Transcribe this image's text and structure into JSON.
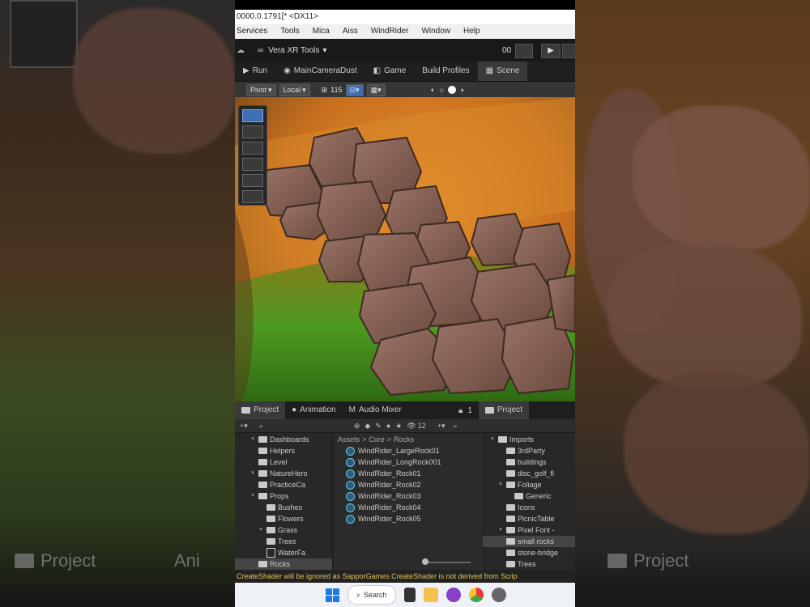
{
  "window": {
    "title": "0000.0.1791[* <DX11>"
  },
  "menu": [
    "Services",
    "Tools",
    "Mica",
    "Aiss",
    "WindRider",
    "Window",
    "Help"
  ],
  "toolbar": {
    "dropdown_label": "Vera XR Tools",
    "counter": "00"
  },
  "tabs": [
    {
      "label": "Run",
      "icon": "run-icon"
    },
    {
      "label": "MainCameraDust",
      "icon": "camera-icon"
    },
    {
      "label": "Game",
      "icon": "game-icon"
    },
    {
      "label": "Build Profiles",
      "icon": ""
    },
    {
      "label": "Scene",
      "icon": "scene-icon"
    }
  ],
  "scene_toolbar": {
    "pivot": "Pivot",
    "local": "Local",
    "snap_value": "115"
  },
  "bottom_left_tabs": [
    {
      "label": "Project",
      "icon": "folder-icon"
    },
    {
      "label": "Animation",
      "icon": "animation-icon"
    },
    {
      "label": "Audio Mixer",
      "icon": "audio-mixer-icon"
    }
  ],
  "bottom_left_counter": "1",
  "bottom_right_tab": {
    "label": "Project"
  },
  "asset_count": "12",
  "project_tree": [
    {
      "label": "Dashboards",
      "arrow": true,
      "depth": 1
    },
    {
      "label": "Helpers",
      "arrow": false,
      "depth": 1
    },
    {
      "label": "Level",
      "arrow": false,
      "depth": 1
    },
    {
      "label": "NatureHero",
      "arrow": true,
      "depth": 1
    },
    {
      "label": "PracticeCa",
      "arrow": false,
      "depth": 1
    },
    {
      "label": "Props",
      "arrow": true,
      "depth": 1
    },
    {
      "label": "Bushes",
      "arrow": false,
      "depth": 2
    },
    {
      "label": "Flowers",
      "arrow": false,
      "depth": 2
    },
    {
      "label": "Grass",
      "arrow": true,
      "depth": 2
    },
    {
      "label": "Trees",
      "arrow": false,
      "depth": 2
    },
    {
      "label": "WaterFa",
      "arrow": false,
      "depth": 2,
      "file": true
    },
    {
      "label": "Rocks",
      "arrow": false,
      "depth": 1,
      "selected": true
    }
  ],
  "breadcrumb": [
    "Assets",
    "Core",
    "Rocks"
  ],
  "assets": [
    "WindRider_LargeRock01",
    "WindRider_LongRock001",
    "WindRider_Rock01",
    "WindRider_Rock02",
    "WindRider_Rock03",
    "WindRider_Rock04",
    "WindRider_Rock05"
  ],
  "project_tree2": [
    {
      "label": "Imports",
      "arrow": true,
      "depth": 0
    },
    {
      "label": "3rdParty",
      "arrow": false,
      "depth": 1
    },
    {
      "label": "buildings",
      "arrow": false,
      "depth": 1
    },
    {
      "label": "disc_golf_fl",
      "arrow": false,
      "depth": 1
    },
    {
      "label": "Foliage",
      "arrow": true,
      "depth": 1
    },
    {
      "label": "Generic",
      "arrow": false,
      "depth": 2
    },
    {
      "label": "Icons",
      "arrow": false,
      "depth": 1
    },
    {
      "label": "PicnicTable",
      "arrow": false,
      "depth": 1
    },
    {
      "label": "Pixel Font -",
      "arrow": true,
      "depth": 1
    },
    {
      "label": "small rocks",
      "arrow": false,
      "depth": 1,
      "selected": true
    },
    {
      "label": "stone-bridge",
      "arrow": false,
      "depth": 1
    },
    {
      "label": "Trees",
      "arrow": false,
      "depth": 1
    }
  ],
  "console": {
    "message": "CreateShader will be ignored as SapporGames.CreateShader is not derived from Scrip"
  },
  "taskbar": {
    "search_label": "Search"
  },
  "background_labels": {
    "project": "Project",
    "animation": "Ani"
  },
  "colors": {
    "accent": "#3f6fb5",
    "console_warning": "#e0c35a"
  }
}
